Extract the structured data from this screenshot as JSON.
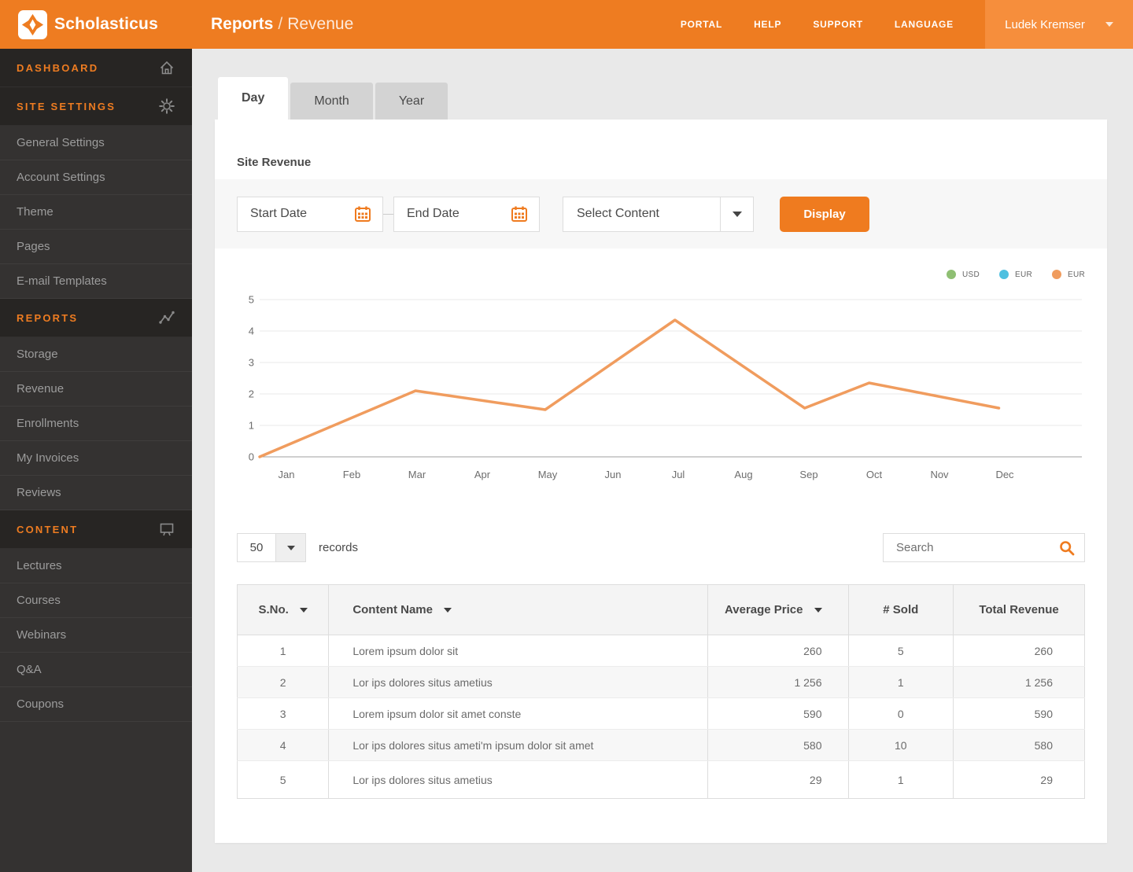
{
  "brand": {
    "name": "Scholasticus"
  },
  "header": {
    "breadcrumb": {
      "section": "Reports",
      "separator": "/",
      "page": "Revenue"
    },
    "nav": [
      "PORTAL",
      "HELP",
      "SUPPORT",
      "LANGUAGE"
    ],
    "user": {
      "name": "Ludek Kremser"
    }
  },
  "sidebar": {
    "items": [
      {
        "type": "section",
        "label": "DASHBOARD",
        "icon": "home-icon"
      },
      {
        "type": "section",
        "label": "SITE SETTINGS",
        "icon": "gear-icon"
      },
      {
        "type": "item",
        "label": "General Settings"
      },
      {
        "type": "item",
        "label": "Account Settings"
      },
      {
        "type": "item",
        "label": "Theme"
      },
      {
        "type": "item",
        "label": "Pages"
      },
      {
        "type": "item",
        "label": "E-mail Templates"
      },
      {
        "type": "section",
        "label": "REPORTS",
        "icon": "line-chart-icon"
      },
      {
        "type": "item",
        "label": "Storage"
      },
      {
        "type": "item",
        "label": "Revenue"
      },
      {
        "type": "item",
        "label": "Enrollments"
      },
      {
        "type": "item",
        "label": "My Invoices"
      },
      {
        "type": "item",
        "label": "Reviews"
      },
      {
        "type": "section",
        "label": "CONTENT",
        "icon": "presentation-icon"
      },
      {
        "type": "item",
        "label": "Lectures"
      },
      {
        "type": "item",
        "label": "Courses"
      },
      {
        "type": "item",
        "label": "Webinars"
      },
      {
        "type": "item",
        "label": "Q&A"
      },
      {
        "type": "item",
        "label": "Coupons"
      }
    ]
  },
  "tabs": [
    {
      "label": "Day",
      "active": true
    },
    {
      "label": "Month",
      "active": false
    },
    {
      "label": "Year",
      "active": false
    }
  ],
  "panel": {
    "title": "Site Revenue",
    "filters": {
      "start_date_label": "Start Date",
      "end_date_label": "End Date",
      "select_content_label": "Select Content",
      "display_button": "Display"
    }
  },
  "chart_data": {
    "type": "line",
    "title": "Site Revenue",
    "categories": [
      "Jan",
      "Feb",
      "Mar",
      "Apr",
      "May",
      "Jun",
      "Jul",
      "Aug",
      "Sep",
      "Oct",
      "Nov",
      "Dec"
    ],
    "ylim": [
      0,
      5
    ],
    "yticks": [
      0,
      1,
      2,
      3,
      4,
      5
    ],
    "grid": true,
    "legend_position": "top-right",
    "legend": [
      {
        "label": "USD",
        "color": "#8fbf73"
      },
      {
        "label": "EUR",
        "color": "#4ec0e0"
      },
      {
        "label": "EUR",
        "color": "#f09c5e"
      }
    ],
    "series": [
      {
        "name": "USD",
        "color": "#8fbf73",
        "values": []
      },
      {
        "name": "EUR",
        "color": "#4ec0e0",
        "values": []
      },
      {
        "name": "EUR",
        "color": "#f09c5e",
        "values": [
          0.35,
          1.2,
          2.1,
          1.8,
          1.5,
          2.9,
          4.35,
          2.95,
          1.55,
          2.35,
          1.95,
          1.55
        ],
        "vertices": [
          {
            "x_frac": 0.0,
            "value": 0
          },
          {
            "x_frac": 0.191,
            "value": 2.1
          },
          {
            "x_frac": 0.35,
            "value": 1.5
          },
          {
            "x_frac": 0.509,
            "value": 4.35
          },
          {
            "x_frac": 0.668,
            "value": 1.55
          },
          {
            "x_frac": 0.747,
            "value": 2.35
          },
          {
            "x_frac": 0.906,
            "value": 1.55
          }
        ]
      }
    ]
  },
  "records_bar": {
    "per_page": "50",
    "records_label": "records",
    "search_placeholder": "Search"
  },
  "table": {
    "columns": [
      {
        "label": "S.No.",
        "sortable": true,
        "align": "ac"
      },
      {
        "label": "Content Name",
        "sortable": true,
        "align": "al"
      },
      {
        "label": "Average Price",
        "sortable": true,
        "align": "ar"
      },
      {
        "label": "# Sold",
        "sortable": false,
        "align": "ac"
      },
      {
        "label": "Total Revenue",
        "sortable": false,
        "align": "ac"
      }
    ],
    "rows": [
      {
        "sno": "1",
        "content": "Lorem ipsum dolor sit",
        "avg_price": "260",
        "sold": "5",
        "revenue": "260"
      },
      {
        "sno": "2",
        "content": "Lor ips dolores situs ametius",
        "avg_price": "1 256",
        "sold": "1",
        "revenue": "1 256"
      },
      {
        "sno": "3",
        "content": "Lorem ipsum dolor sit amet conste",
        "avg_price": "590",
        "sold": "0",
        "revenue": "590"
      },
      {
        "sno": "4",
        "content": "Lor ips dolores situs ameti'm ipsum dolor sit amet",
        "avg_price": "580",
        "sold": "10",
        "revenue": "580"
      },
      {
        "sno": "5",
        "content": "Lor ips dolores situs ametius",
        "avg_price": "29",
        "sold": "1",
        "revenue": "29"
      }
    ]
  },
  "colors": {
    "accent_orange": "#ee7c21",
    "button_orange": "#ef7b1f",
    "user_block_orange": "#f68e3c",
    "sidebar_bg": "#343231",
    "section_bg": "#272523",
    "line_orange": "#f09c5e",
    "page_bg": "#e9e9e9"
  }
}
